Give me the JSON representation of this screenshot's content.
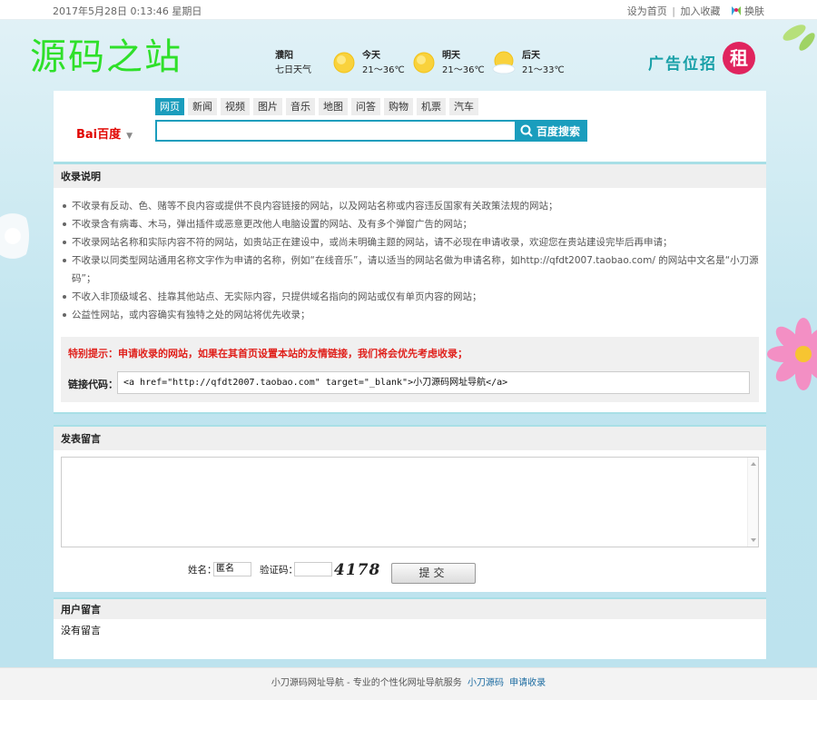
{
  "topbar": {
    "datetime": "2017年5月28日 0:13:46 星期日",
    "set_home": "设为首页",
    "separator": "|",
    "add_favorite": "加入收藏",
    "change_skin": "换肤"
  },
  "header": {
    "logo": "源码之站",
    "weather": {
      "city": "濮阳",
      "source": "七日天气",
      "days": [
        {
          "label": "今天",
          "temp": "21～36℃",
          "icon": "sun-icon"
        },
        {
          "label": "明天",
          "temp": "21～36℃",
          "icon": "sun-icon"
        },
        {
          "label": "后天",
          "temp": "21～33℃",
          "icon": "cloud-sun-icon"
        }
      ]
    },
    "ad_text": "广告位招",
    "ad_badge": "租"
  },
  "search": {
    "engine_logo": "Bai百度",
    "tabs": [
      "网页",
      "新闻",
      "视频",
      "图片",
      "音乐",
      "地图",
      "问答",
      "购物",
      "机票",
      "汽车"
    ],
    "active_tab": "网页",
    "input_value": "",
    "button_label": "百度搜索"
  },
  "rules": {
    "title": "收录说明",
    "items": [
      "不收录有反动、色、赌等不良内容或提供不良内容链接的网站，以及网站名称或内容违反国家有关政策法规的网站；",
      "不收录含有病毒、木马，弹出插件或恶意更改他人电脑设置的网站、及有多个弹窗广告的网站；",
      "不收录网站名称和实际内容不符的网站，如贵站正在建设中，或尚未明确主题的网站，请不必现在申请收录，欢迎您在贵站建设完毕后再申请；",
      "不收录以同类型网站通用名称文字作为申请的名称，例如“在线音乐”，请以适当的网站名做为申请名称，如http://qfdt2007.taobao.com/ 的网站中文名是“小刀源码”；",
      "不收入非顶级域名、挂靠其他站点、无实际内容，只提供域名指向的网站或仅有单页内容的网站；",
      "公益性网站，或内容确实有独特之处的网站将优先收录；"
    ],
    "notice": "特别提示：申请收录的网站，如果在其首页设置本站的友情链接，我们将会优先考虑收录；",
    "link_code_label": "链接代码：",
    "link_code": "<a href=\"http://qfdt2007.taobao.com\" target=\"_blank\">小刀源码网址导航</a>"
  },
  "comment": {
    "title": "发表留言",
    "textarea_value": "",
    "name_label": "姓名：",
    "name_value": "匿名",
    "captcha_label": "验证码：",
    "captcha_value": "",
    "captcha_image_text": "4178",
    "submit_label": "提交"
  },
  "messages": {
    "title": "用户留言",
    "empty_text": "没有留言"
  },
  "footer": {
    "text": "小刀源码网址导航 - 专业的个性化网址导航服务",
    "link1": "小刀源码",
    "link2": "申请收录"
  },
  "colors": {
    "accent": "#1a9dbd",
    "logo_green": "#2fe02a",
    "notice_red": "#e0201b",
    "ad_teal": "#19a0a8",
    "badge_pink": "#e0245e"
  }
}
